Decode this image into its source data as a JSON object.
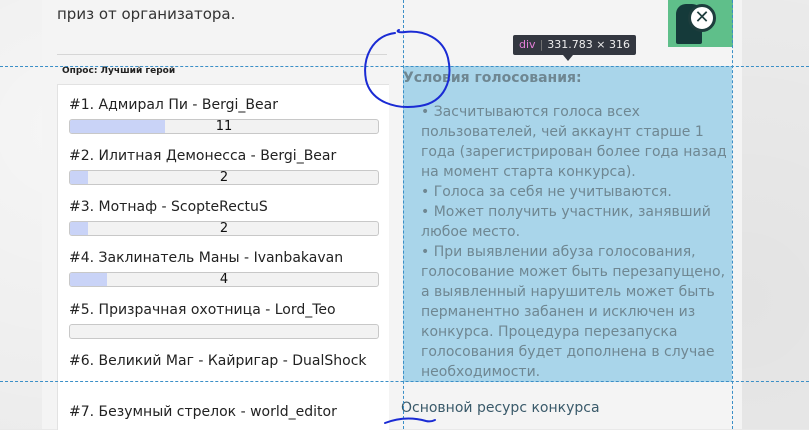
{
  "page": {
    "top_text": "приз от организатора."
  },
  "poll": {
    "title": "Опрос: Лучший герой",
    "items": [
      {
        "label": "#1. Адмирал Пи - Bergi_Bear",
        "votes": "11",
        "fill_fraction": 0.31
      },
      {
        "label": "#2. Илитная Демонесса - Bergi_Bear",
        "votes": "2",
        "fill_fraction": 0.06
      },
      {
        "label": "#3. Мотнаф - ScopteRectuS",
        "votes": "2",
        "fill_fraction": 0.06
      },
      {
        "label": "#4. Заклинатель Маны - Ivanbakavan",
        "votes": "4",
        "fill_fraction": 0.12
      },
      {
        "label": "#5. Призрачная охотница - Lord_Teo",
        "votes": "",
        "fill_fraction": 0
      },
      {
        "label": "#6. Великий Маг - Кайригар - DualShock",
        "votes": "",
        "fill_fraction": 0
      },
      {
        "label": "#7. Безумный стрелок - world_editor",
        "votes": "",
        "fill_fraction": 0
      }
    ]
  },
  "conditions": {
    "title": "Условия голосования:",
    "rules": [
      "• Засчитываются голоса всех пользователей, чей аккаунт старше 1 года (зарегистрирован более года назад на момент старта конкурса).",
      "• Голоса за себя не учитываются.",
      "• Может получить участник, занявший любое место.",
      "• При выявлении абуза голосования, голосование может быть перезапущено, а выявленный нарушитель может быть перманентно забанен и исключен из конкурса. Процедура перезапуска голосования будет дополнена в случае необходимости."
    ],
    "resource_link": "Основной ресурс конкурса"
  },
  "devtools_tooltip": {
    "tag": "div",
    "dimensions": "331.783 × 316"
  },
  "colors": {
    "highlight": "#a9d5ea",
    "bar_fill": "#c9d3f7",
    "guide": "#3b8fc7",
    "scribble": "#1a2bd4"
  },
  "icons": {
    "avatar": "hero-avatar-icon",
    "close": "close-icon"
  }
}
